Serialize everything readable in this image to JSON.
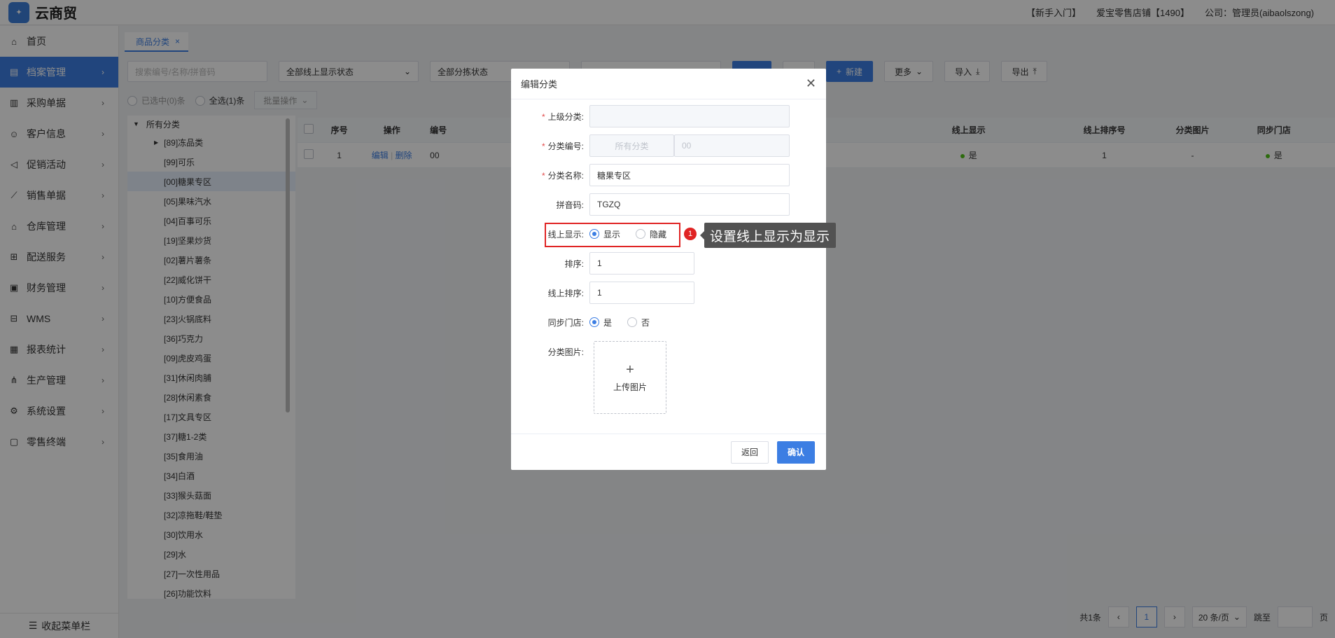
{
  "header": {
    "logo_text": "云商贸",
    "app_name": "云商贸",
    "links": [
      "【新手入门】",
      "爱宝零售店铺【1490】",
      "公司：管理员(aibaolszong)"
    ]
  },
  "sidebar": {
    "items": [
      {
        "label": "首页",
        "icon": "home-icon",
        "glyph": "⌂"
      },
      {
        "label": "档案管理",
        "icon": "archive-icon",
        "glyph": "▤",
        "active": true
      },
      {
        "label": "采购单据",
        "icon": "purchase-icon",
        "glyph": "▥"
      },
      {
        "label": "客户信息",
        "icon": "user-icon",
        "glyph": "☺"
      },
      {
        "label": "促销活动",
        "icon": "megaphone-icon",
        "glyph": "◁"
      },
      {
        "label": "销售单据",
        "icon": "chart-line-icon",
        "glyph": "⟋"
      },
      {
        "label": "仓库管理",
        "icon": "warehouse-icon",
        "glyph": "⌂"
      },
      {
        "label": "配送服务",
        "icon": "cart-icon",
        "glyph": "⊞"
      },
      {
        "label": "财务管理",
        "icon": "finance-icon",
        "glyph": "▣"
      },
      {
        "label": "WMS",
        "icon": "truck-icon",
        "glyph": "⊟"
      },
      {
        "label": "报表统计",
        "icon": "bar-chart-icon",
        "glyph": "▦"
      },
      {
        "label": "生产管理",
        "icon": "network-icon",
        "glyph": "⋔"
      },
      {
        "label": "系统设置",
        "icon": "gear-icon",
        "glyph": "⚙"
      },
      {
        "label": "零售终端",
        "icon": "bag-icon",
        "glyph": "▢"
      }
    ],
    "collapse_label": "收起菜单栏"
  },
  "tabs": [
    {
      "label": "商品分类",
      "close": "×"
    }
  ],
  "filters": {
    "search_placeholder": "搜索编号/名称/拼音码",
    "online_status": "全部线上显示状态",
    "sort_status": "全部分拣状态",
    "new_label": "新建",
    "more_label": "更多",
    "import_label": "导入",
    "export_label": "导出"
  },
  "selection": {
    "selected": "已选中(0)条",
    "select_all": "全选(1)条",
    "batch": "批量操作"
  },
  "tree": {
    "root": "所有分类",
    "items": [
      "[89]冻品类",
      "[99]可乐",
      "[00]糖果专区",
      "[05]果味汽水",
      "[04]百事可乐",
      "[19]坚果炒货",
      "[02]薯片薯条",
      "[22]威化饼干",
      "[10]方便食品",
      "[23]火锅底料",
      "[36]巧克力",
      "[09]虎皮鸡蛋",
      "[31]休闲肉脯",
      "[28]休闲素食",
      "[17]文具专区",
      "[37]糖1-2类",
      "[35]食用油",
      "[34]白酒",
      "[33]猴头菇面",
      "[32]凉拖鞋/鞋垫",
      "[30]饮用水",
      "[29]水",
      "[27]一次性用品",
      "[26]功能饮料"
    ]
  },
  "table": {
    "headers": [
      "序号",
      "操作",
      "编号",
      "线上显示",
      "线上排序号",
      "分类图片",
      "同步门店"
    ],
    "row": {
      "index": "1",
      "edit": "编辑",
      "delete": "删除",
      "code": "00",
      "online": "是",
      "online_sort": "1",
      "image": "-",
      "sync": "是"
    }
  },
  "pager": {
    "total": "共1条",
    "page": "1",
    "size": "20 条/页",
    "jump": "跳至",
    "unit": "页"
  },
  "dialog": {
    "title": "编辑分类",
    "parent_label": "上级分类:",
    "code_label": "分类编号:",
    "code_prefix": "所有分类",
    "code_placeholder": "00",
    "name_label": "分类名称:",
    "name_value": "糖果专区",
    "pinyin_label": "拼音码:",
    "pinyin_value": "TGZQ",
    "online_label": "线上显示:",
    "online_show": "显示",
    "online_hide": "隐藏",
    "sort_label": "排序:",
    "sort_value": "1",
    "online_sort_label": "线上排序:",
    "online_sort_value": "1",
    "sync_label": "同步门店:",
    "sync_yes": "是",
    "sync_no": "否",
    "image_label": "分类图片:",
    "upload_label": "上传图片",
    "back_label": "返回",
    "confirm_label": "确认"
  },
  "annotation": {
    "badge": "1",
    "tip": "设置线上显示为显示"
  },
  "colors": {
    "primary": "#3c7ee3",
    "highlight": "#e02424",
    "success": "#52c41a"
  }
}
